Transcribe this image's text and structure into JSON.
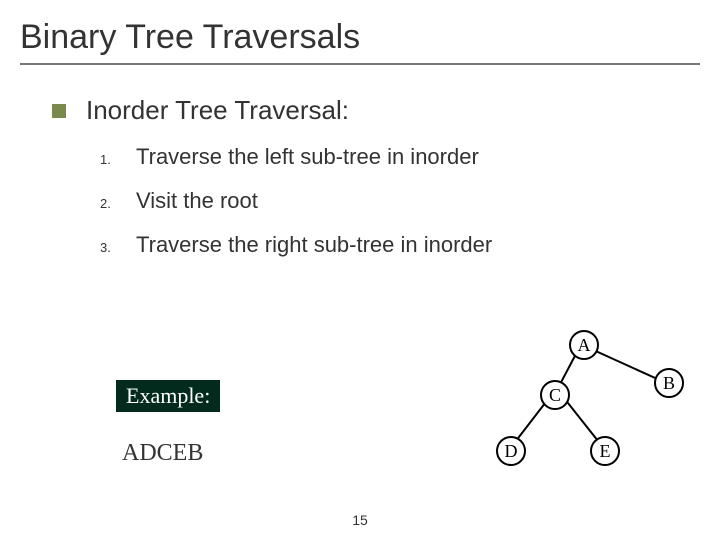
{
  "title": "Binary Tree Traversals",
  "section": "Inorder Tree Traversal:",
  "steps": [
    {
      "num": "1.",
      "text": "Traverse the left sub-tree in inorder"
    },
    {
      "num": "2.",
      "text": "Visit the root"
    },
    {
      "num": "3.",
      "text": "Traverse the right sub-tree in inorder"
    }
  ],
  "example_label": "Example:",
  "result": "ADCEB",
  "tree": {
    "nodes": {
      "a": "A",
      "b": "B",
      "c": "C",
      "d": "D",
      "e": "E"
    }
  },
  "slide_number": "15"
}
